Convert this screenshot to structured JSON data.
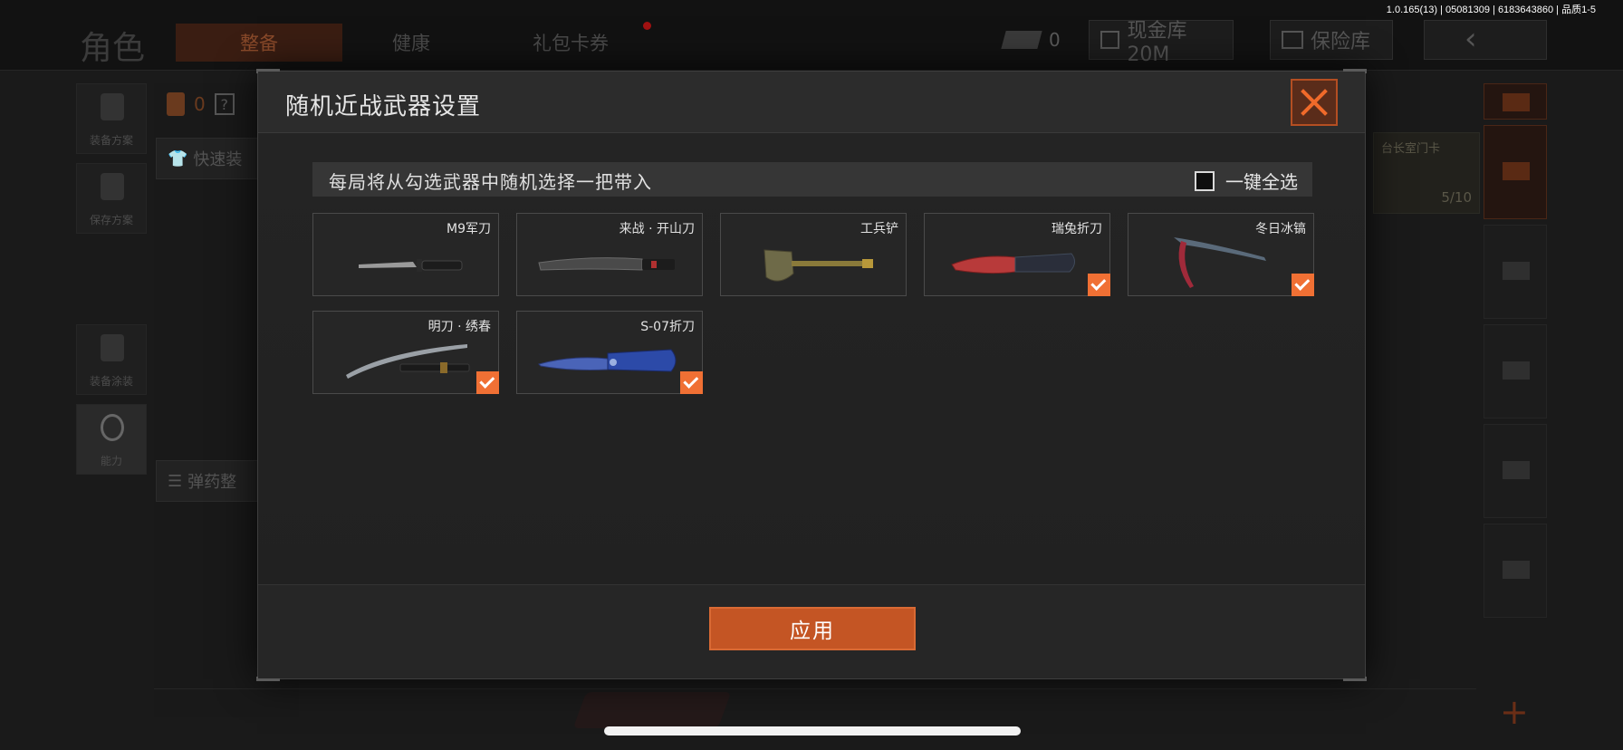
{
  "status": {
    "version": "1.0.165(13) | 05081309 | 6183643860 | 品质1-5"
  },
  "background": {
    "page_title": "角色",
    "tabs": [
      {
        "label": "整备",
        "active": true
      },
      {
        "label": "健康",
        "active": false
      },
      {
        "label": "礼包卡券",
        "active": false,
        "badge": true
      }
    ],
    "currency_count": "0",
    "cash_vault": "现金库 20M",
    "insurance_vault": "保险库",
    "left_items": [
      {
        "label": "装备方案"
      },
      {
        "label": "保存方案"
      },
      {
        "label": "装备涂装"
      },
      {
        "label": "能力"
      }
    ],
    "loadout_count": "0",
    "quick_equip": "快速装",
    "ammo_sort": "弹药整",
    "card_title": "台长室门卡",
    "card_count": "5/10"
  },
  "modal": {
    "title": "随机近战武器设置",
    "info_text": "每局将从勾选武器中随机选择一把带入",
    "select_all_label": "一键全选",
    "select_all_checked": false,
    "apply_label": "应用",
    "weapons": [
      {
        "name": "M9军刀",
        "checked": false,
        "icon": "bayonet-icon"
      },
      {
        "name": "来战 · 开山刀",
        "checked": false,
        "icon": "machete-icon"
      },
      {
        "name": "工兵铲",
        "checked": false,
        "icon": "shovel-icon"
      },
      {
        "name": "瑞兔折刀",
        "checked": true,
        "icon": "folding-knife-icon"
      },
      {
        "name": "冬日冰镐",
        "checked": true,
        "icon": "ice-pick-icon"
      },
      {
        "name": "明刀 · 绣春",
        "checked": true,
        "icon": "katana-icon"
      },
      {
        "name": "S-07折刀",
        "checked": true,
        "icon": "blue-knife-icon"
      }
    ]
  },
  "colors": {
    "accent": "#f07034",
    "apply": "#c45524"
  }
}
